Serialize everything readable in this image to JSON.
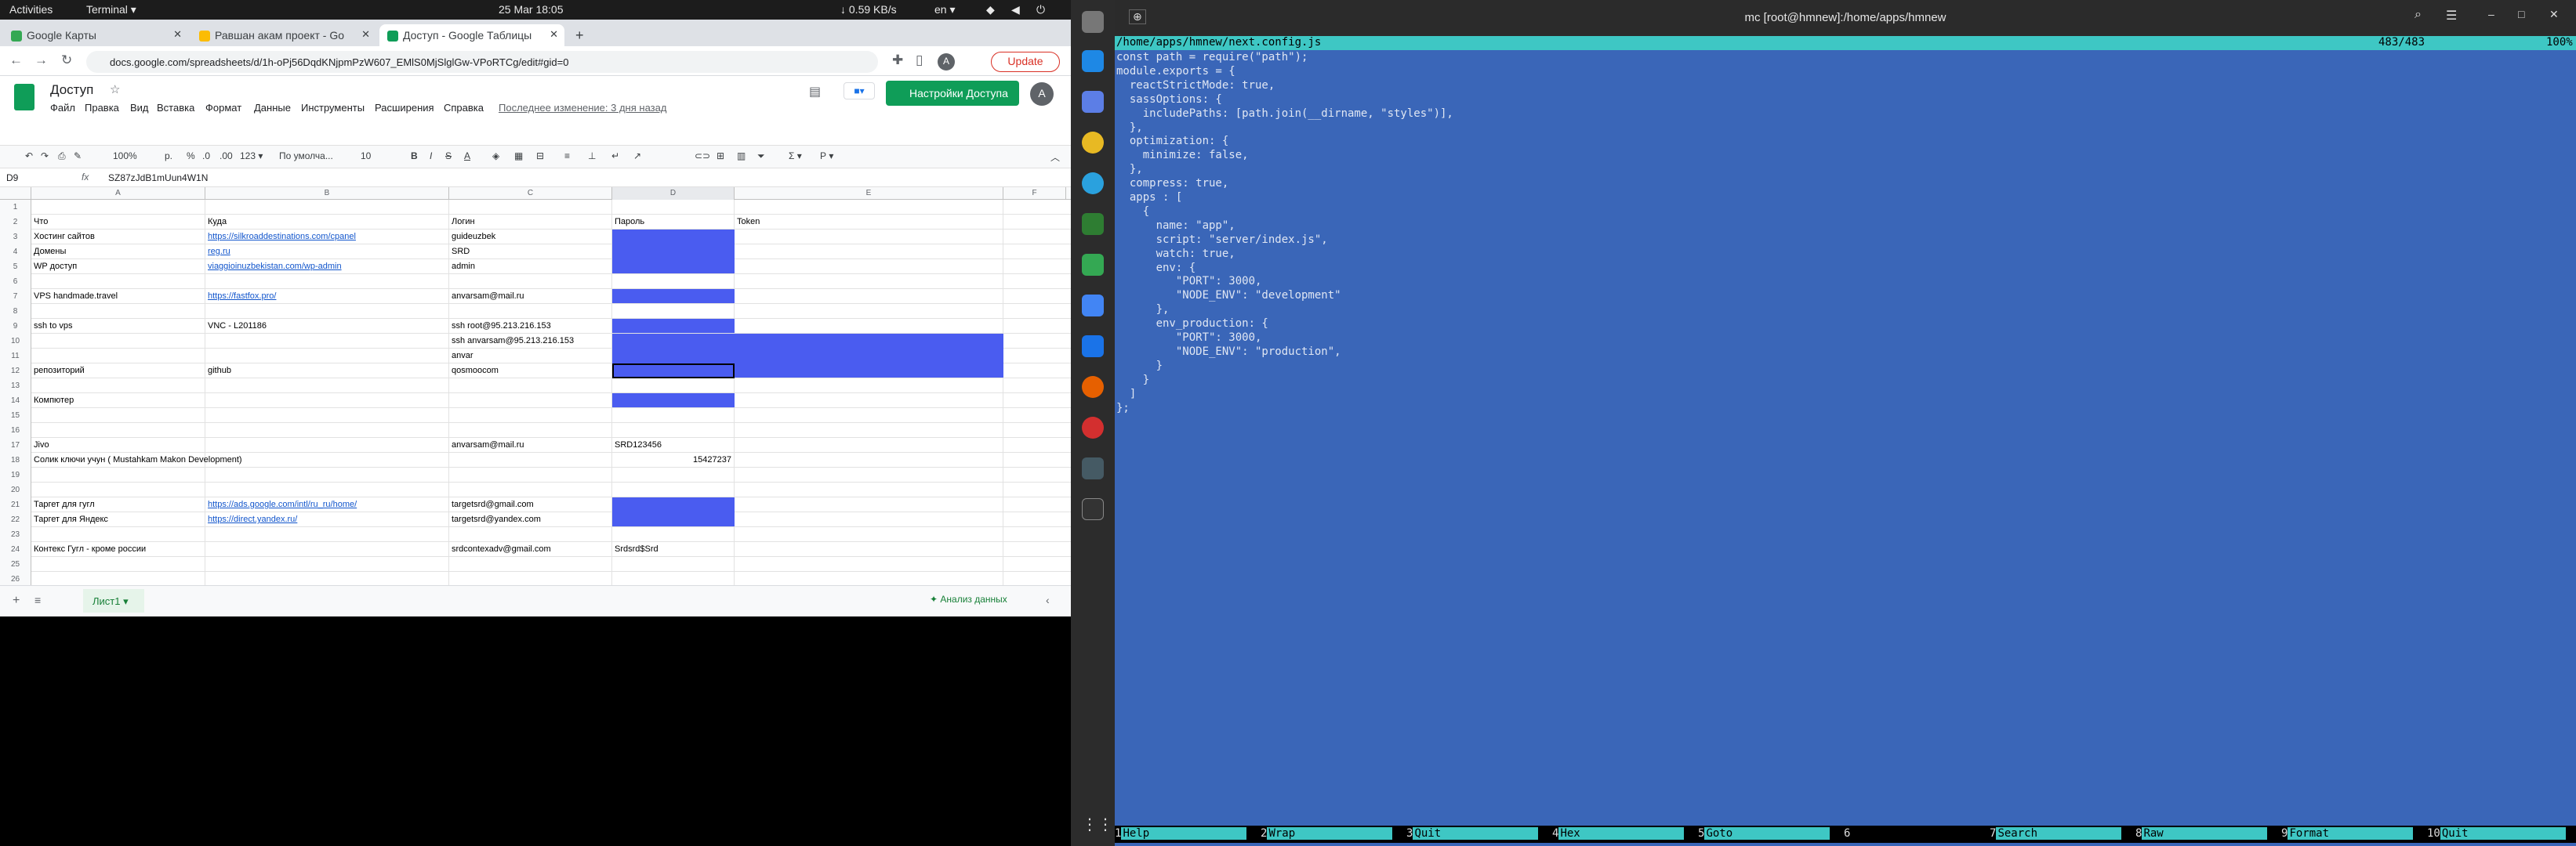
{
  "topbar": {
    "activities": "Activities",
    "app": "Terminal ▾",
    "datetime": "25 Mar  18:05",
    "net": "↓ 0.59 KB/s",
    "lang": "en ▾"
  },
  "browser": {
    "tabs": [
      {
        "label": "Google Карты"
      },
      {
        "label": "Равшан акам проект - Go"
      },
      {
        "label": "Доступ - Google Таблицы"
      }
    ],
    "url": "docs.google.com/spreadsheets/d/1h-oPj56DqdKNjpmPzW607_EMlS0MjSlglGw-VPoRTCg/edit#gid=0",
    "update_label": "Update"
  },
  "sheets": {
    "title": "Доступ",
    "menu": [
      "Файл",
      "Правка",
      "Вид",
      "Вставка",
      "Формат",
      "Данные",
      "Инструменты",
      "Расширения",
      "Справка"
    ],
    "last_edit": "Последнее изменение: 3 дня назад",
    "share_label": "Настройки Доступа",
    "avatar": "A",
    "zoom": "100%",
    "font": "По умолча...",
    "font_size": "10",
    "cell_ref": "D9",
    "formula": "SZ87zJdB1mUun4W1N",
    "sheet_tab": "Лист1",
    "explore_label": "Анализ данных",
    "columns": [
      "A",
      "B",
      "C",
      "D",
      "E",
      "F"
    ],
    "rows": [
      {
        "n": "1",
        "a": "",
        "b": "",
        "c": "",
        "d": "",
        "e": ""
      },
      {
        "n": "2",
        "a": "Что",
        "b": "Куда",
        "c": "Логин",
        "d": "Пароль",
        "e": "Token"
      },
      {
        "n": "3",
        "a": "Хостинг сайтов",
        "b": "https://silkroaddestinations.com/cpanel",
        "c": "guideuzbek",
        "d": "",
        "e": ""
      },
      {
        "n": "4",
        "a": "Домены",
        "b": "reg.ru",
        "c": "SRD",
        "d": "",
        "e": ""
      },
      {
        "n": "5",
        "a": "WP доступ",
        "b": "viaggioinuzbekistan.com/wp-admin",
        "c": "admin",
        "d": "",
        "e": ""
      },
      {
        "n": "6",
        "a": "",
        "b": "",
        "c": "",
        "d": "",
        "e": ""
      },
      {
        "n": "7",
        "a": "VPS handmade.travel",
        "b": "https://fastfox.pro/",
        "c": "anvarsam@mail.ru",
        "d": "",
        "e": ""
      },
      {
        "n": "8",
        "a": "",
        "b": "",
        "c": "",
        "d": "",
        "e": ""
      },
      {
        "n": "9",
        "a": "ssh to vps",
        "b": "VNC - L201186",
        "c": "ssh root@95.213.216.153",
        "d": "",
        "e": ""
      },
      {
        "n": "10",
        "a": "",
        "b": "",
        "c": "ssh anvarsam@95.213.216.153",
        "d": "",
        "e": ""
      },
      {
        "n": "11",
        "a": "",
        "b": "",
        "c": "anvar",
        "d": "",
        "e": ""
      },
      {
        "n": "12",
        "a": "репозиторий",
        "b": "github",
        "c": "qosmoocom",
        "d": "",
        "e": ""
      },
      {
        "n": "13",
        "a": "",
        "b": "",
        "c": "",
        "d": "",
        "e": ""
      },
      {
        "n": "14",
        "a": "Компютер",
        "b": "",
        "c": "",
        "d": "",
        "e": ""
      },
      {
        "n": "15",
        "a": "",
        "b": "",
        "c": "",
        "d": "",
        "e": ""
      },
      {
        "n": "16",
        "a": "",
        "b": "",
        "c": "",
        "d": "",
        "e": ""
      },
      {
        "n": "17",
        "a": "Jivo",
        "b": "",
        "c": "anvarsam@mail.ru",
        "d": "SRD123456",
        "e": ""
      },
      {
        "n": "18",
        "a": "Солик ключи учун ( Mustahkam Makon Development)",
        "b": "",
        "c": "",
        "d": "15427237",
        "e": ""
      },
      {
        "n": "19",
        "a": "",
        "b": "",
        "c": "",
        "d": "",
        "e": ""
      },
      {
        "n": "20",
        "a": "",
        "b": "",
        "c": "",
        "d": "",
        "e": ""
      },
      {
        "n": "21",
        "a": "Таргет для гугл",
        "b": "https://ads.google.com/intl/ru_ru/home/",
        "c": "targetsrd@gmail.com",
        "d": "",
        "e": ""
      },
      {
        "n": "22",
        "a": "Таргет для Яндекс",
        "b": "https://direct.yandex.ru/",
        "c": "targetsrd@yandex.com",
        "d": "",
        "e": ""
      },
      {
        "n": "23",
        "a": "",
        "b": "",
        "c": "",
        "d": "",
        "e": ""
      },
      {
        "n": "24",
        "a": "Контекс Гугл - кроме россии",
        "b": "",
        "c": "srdcontexadv@gmail.com",
        "d": "Srdsrd$Srd",
        "e": ""
      },
      {
        "n": "25",
        "a": "",
        "b": "",
        "c": "",
        "d": "",
        "e": ""
      },
      {
        "n": "26",
        "a": "",
        "b": "",
        "c": "",
        "d": "",
        "e": ""
      }
    ]
  },
  "terminal": {
    "title": "mc [root@hmnew]:/home/apps/hmnew",
    "file_path": "/home/apps/hmnew/next.config.js",
    "position": "483/483",
    "percent": "100%",
    "code": [
      "const path = require(\"path\");",
      "module.exports = {",
      "  reactStrictMode: true,",
      "  sassOptions: {",
      "    includePaths: [path.join(__dirname, \"styles\")],",
      "  },",
      "  optimization: {",
      "    minimize: false,",
      "  },",
      "  compress: true,",
      "  apps : [",
      "    {",
      "      name: \"app\",",
      "      script: \"server/index.js\",",
      "      watch: true,",
      "      env: {",
      "         \"PORT\": 3000,",
      "         \"NODE_ENV\": \"development\"",
      "      },",
      "      env_production: {",
      "         \"PORT\": 3000,",
      "         \"NODE_ENV\": \"production\",",
      "      }",
      "    }",
      "  ]",
      "};"
    ],
    "fkeys": [
      {
        "n": "1",
        "l": "Help"
      },
      {
        "n": "2",
        "l": "Wrap"
      },
      {
        "n": "3",
        "l": "Quit"
      },
      {
        "n": "4",
        "l": "Hex"
      },
      {
        "n": "5",
        "l": "Goto"
      },
      {
        "n": "6",
        "l": ""
      },
      {
        "n": "7",
        "l": "Search"
      },
      {
        "n": "8",
        "l": "Raw"
      },
      {
        "n": "9",
        "l": "Format"
      },
      {
        "n": "10",
        "l": "Quit"
      }
    ]
  }
}
